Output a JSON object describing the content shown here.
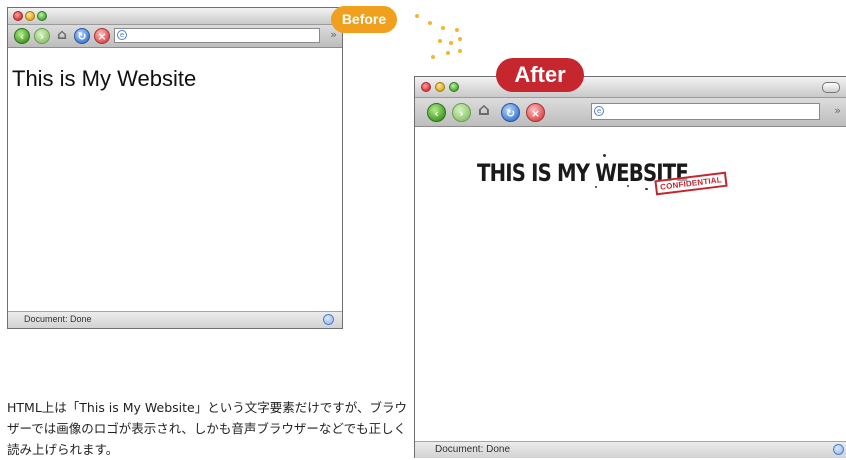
{
  "badges": {
    "before": "Before",
    "after": "After"
  },
  "before_window": {
    "page_heading": "This is My Website",
    "status_text": "Document: Done",
    "toolbar_icons": [
      "back-icon",
      "forward-icon",
      "home-icon",
      "reload-icon",
      "stop-icon",
      "globe-icon"
    ]
  },
  "after_window": {
    "logo_text": "THIS IS MY WEBSITE",
    "stamp_text": "CONFIDENTIAL",
    "status_text": "Document: Done",
    "toolbar_icons": [
      "back-icon",
      "forward-icon",
      "home-icon",
      "reload-icon",
      "stop-icon",
      "globe-icon"
    ]
  },
  "caption": "HTML上は「This is My Website」という文字要素だけですが、ブラウザーでは画像のロゴが表示され、しかも音声ブラウザーなどでも正しく読み上げられます。",
  "colors": {
    "before_badge": "#f0a01c",
    "after_badge": "#c6262e",
    "dots": "#f2b62e"
  }
}
